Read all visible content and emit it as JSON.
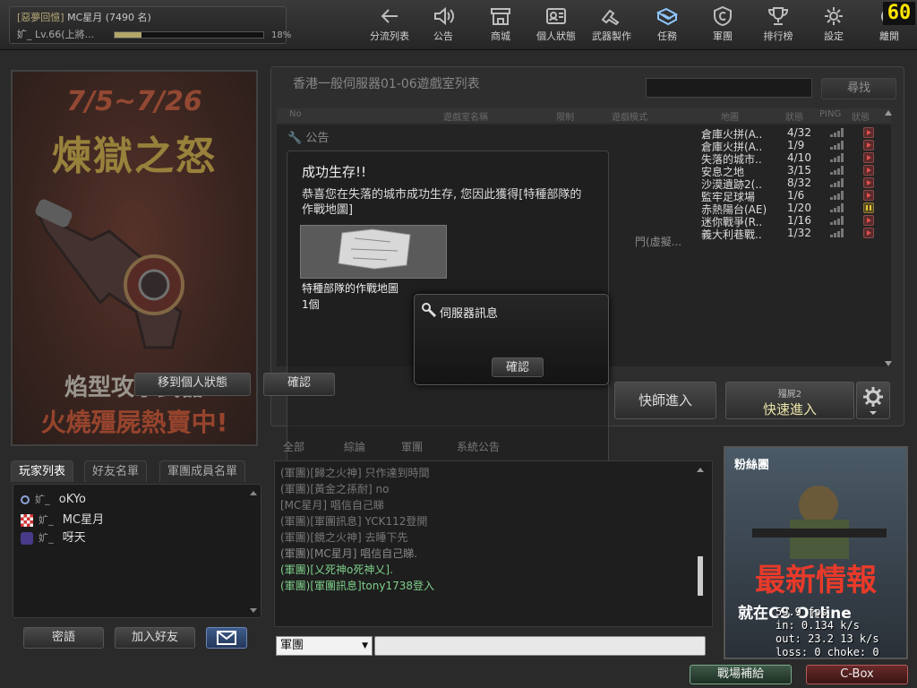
{
  "fps_counter": "60",
  "user": {
    "clan_tag": "[惡夢回憶]",
    "name": "MC星月",
    "rank_count": "(7490 名)",
    "clan_mark": "㚧_",
    "level_text": "Lv.66(上將...",
    "xp_percent": "18%",
    "xp_fraction": 0.18
  },
  "nav": [
    {
      "label": "分流列表",
      "icon": "back-arrow-icon"
    },
    {
      "label": "公告",
      "icon": "speaker-icon"
    },
    {
      "label": "商城",
      "icon": "shop-icon"
    },
    {
      "label": "個人狀態",
      "icon": "profile-card-icon"
    },
    {
      "label": "武器製作",
      "icon": "weapon-craft-icon"
    },
    {
      "label": "任務",
      "icon": "mission-icon"
    },
    {
      "label": "軍團",
      "icon": "clan-emblem-icon"
    },
    {
      "label": "排行榜",
      "icon": "trophy-icon"
    },
    {
      "label": "設定",
      "icon": "gear-icon"
    },
    {
      "label": "離開",
      "icon": "power-icon"
    }
  ],
  "promo": {
    "date": "7/5~7/26",
    "title": "煉獄之怒",
    "sub1": "焰型攻擊武器",
    "sub2": "火燒殭屍熱賣中!"
  },
  "friends": {
    "tabs": [
      "玩家列表",
      "好友名單",
      "軍團成員名單"
    ],
    "items": [
      {
        "clan": "㚧_",
        "name": "oKYo"
      },
      {
        "clan": "㚧_",
        "name": "MC星月"
      },
      {
        "clan": "㚧_",
        "name": "呀天"
      }
    ],
    "whisper_label": "密語",
    "add_friend_label": "加入好友"
  },
  "rooms": {
    "title": "香港一般伺服器01-06遊戲室列表",
    "find_label": "尋找",
    "headers": {
      "no": "No",
      "name": "遊戲室名稱",
      "limit": "限制",
      "mode": "遊戲模式",
      "map": "地圖",
      "state": "狀態",
      "ping": "PING",
      "status": "狀態"
    },
    "notice_label": "公告",
    "rows": [
      {
        "map": "倉庫火拼(A..",
        "count": "4/32",
        "status": "play"
      },
      {
        "map": "倉庫火拼(A..",
        "count": "1/9",
        "status": "play"
      },
      {
        "map": "失落的城市..",
        "count": "4/10",
        "status": "play"
      },
      {
        "map": "安息之地",
        "count": "3/15",
        "status": "play"
      },
      {
        "map": "沙漠遺跡2(..",
        "count": "8/32",
        "status": "play"
      },
      {
        "map": "監牢足球場",
        "count": "1/6",
        "status": "play"
      },
      {
        "map": "赤熱陽台(AE)",
        "count": "1/20",
        "status": "paused"
      },
      {
        "map": "迷你戰爭(R..",
        "count": "1/16",
        "status": "play"
      },
      {
        "map": "義大利巷戰..",
        "count": "1/32",
        "status": "play"
      }
    ],
    "partial_mode_text": "門(虛擬..."
  },
  "reward": {
    "title": "成功生存!!",
    "message": "恭喜您在失落的城市成功生存, 您因此獲得[特種部隊的作戰地圖]",
    "item_name": "特種部隊的作戰地圖",
    "item_qty": "1個",
    "goto_profile": "移到個人狀態",
    "confirm": "確認"
  },
  "server_msg": {
    "title": "伺服器訊息",
    "confirm": "確認"
  },
  "join": {
    "quick": "快師進入",
    "fast_mode": "殭屍2",
    "fast": "快速進入"
  },
  "chat": {
    "tabs": [
      "全部",
      "綜論",
      "軍團",
      "系統公告"
    ],
    "lines": [
      {
        "text": "(軍團)[歸之火神] 只作達到時間",
        "color": "#777"
      },
      {
        "text": "(軍團)[黃金之孫耐] no",
        "color": "#777"
      },
      {
        "text": "[MC星月] 唱信自己睇",
        "color": "#777"
      },
      {
        "text": "(軍團)[軍團訊息] YCK112登開",
        "color": "#777"
      },
      {
        "text": "(軍團)[鏡之火神] 去睡下先",
        "color": "#777"
      },
      {
        "text": "(軍團)[MC星月] 唱信自己睇.",
        "color": "#8a8a8a"
      },
      {
        "text": "(軍團)[乂死神o死神乂].",
        "color": "#7ecf8a"
      },
      {
        "text": "(軍團)[軍團訊息]tony1738登入",
        "color": "#7ecf8a"
      }
    ],
    "channel": "軍團"
  },
  "ad": {
    "fans": "粉絲團",
    "headline": "最新情報",
    "sub": "就在CS Online"
  },
  "net_stats": [
    "59.9 fps",
    "in: 0.134 k/s",
    "out: 23.2 13 k/s",
    "loss: 0 choke: 0"
  ],
  "bottom": {
    "supply": "戰場補給",
    "cbox": "C-Box"
  },
  "colors": {
    "accent_xp": "#b3a66a",
    "fps_yellow": "#ffe600",
    "chat_clan_green": "#7ecf8a"
  }
}
